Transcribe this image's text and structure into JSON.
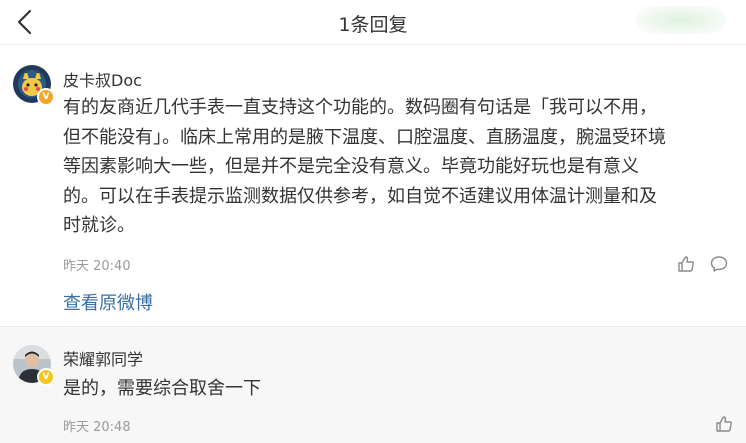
{
  "header": {
    "title": "1条回复"
  },
  "main_comment": {
    "username": "皮卡叔Doc",
    "badge": "V",
    "badge_color": "#f5a623",
    "text_lines": [
      "有的友商近几代手表一直支持这个功能的。数码圈有句话是「我可以不用，",
      "但不能没有」。临床上常用的是腋下温度、口腔温度、直肠温度，腕温受环境",
      "等因素影响大一些，但是并不是完全没有意义。毕竟功能好玩也是有意义",
      "的。可以在手表提示监测数据仅供参考，如自觉不适建议用体温计测量和及",
      "时就诊。"
    ],
    "timestamp": "昨天 20:40",
    "view_original": "查看原微博"
  },
  "reply": {
    "username": "荣耀郭同学",
    "badge": "V",
    "badge_color": "#f5c518",
    "text": "是的，需要综合取舍一下",
    "timestamp": "昨天 20:48"
  },
  "colors": {
    "link": "#3a6fa6",
    "timestamp": "#9b9b9b",
    "reply_bg": "#f7f7f7"
  }
}
